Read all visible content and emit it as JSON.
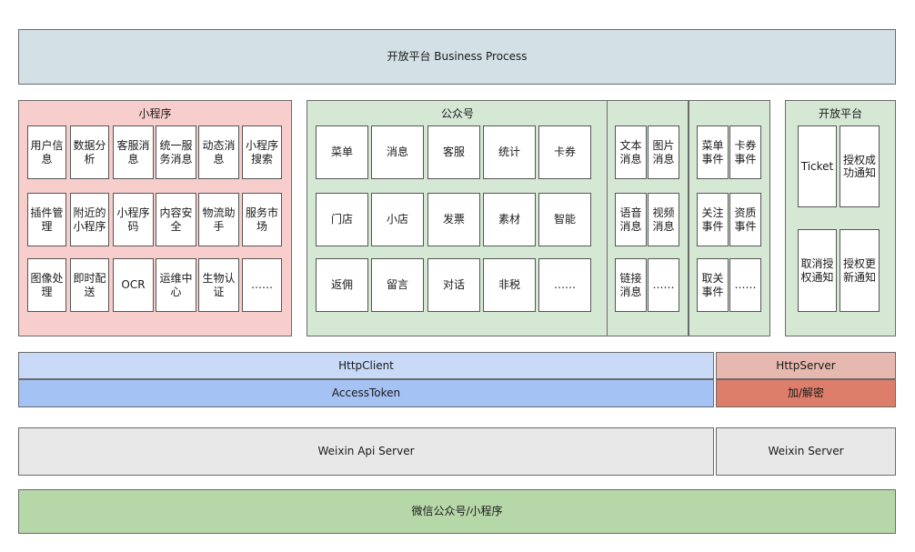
{
  "top": "开放平台 Business Process",
  "mini": {
    "title": "小程序",
    "items": [
      "用户信\n息",
      "数据分\n析",
      "客服消\n息",
      "统一服\n务消息",
      "动态消\n息",
      "小程序\n搜索",
      "插件管\n理",
      "附近的\n小程序",
      "小程序\n码",
      "内容安\n全",
      "物流助\n手",
      "服务市\n场",
      "图像处\n理",
      "即时配\n送",
      "OCR",
      "运维中\n心",
      "生物认\n证",
      "……"
    ]
  },
  "gzh": {
    "title": "公众号",
    "items": [
      "菜单",
      "消息",
      "客服",
      "统计",
      "卡券",
      "门店",
      "小店",
      "发票",
      "素材",
      "智能",
      "返佣",
      "留言",
      "对话",
      "非税",
      "……"
    ],
    "messages": [
      "文本\n消息",
      "图片\n消息",
      "语音\n消息",
      "视频\n消息",
      "链接\n消息",
      "……"
    ],
    "events": [
      "菜单\n事件",
      "卡券\n事件",
      "关注\n事件",
      "资质\n事件",
      "取关\n事件",
      "……"
    ]
  },
  "open": {
    "title": "开放平台",
    "items": [
      "Ticket",
      "授权成\n功通知",
      "取消授\n权通知",
      "授权更\n新通知"
    ]
  },
  "http_client": "HttpClient",
  "access_token": "AccessToken",
  "http_server": "HttpServer",
  "crypto": "加/解密",
  "api_server": "Weixin Api Server",
  "weixin_server": "Weixin Server",
  "bottom": "微信公众号/小程序"
}
